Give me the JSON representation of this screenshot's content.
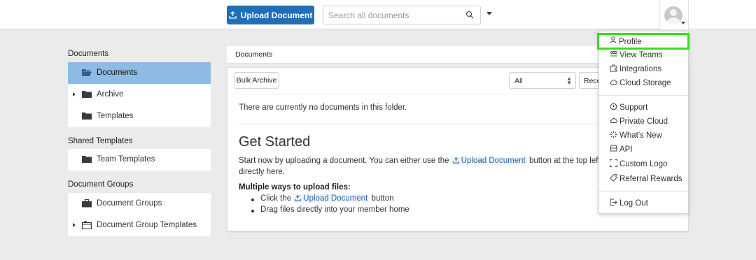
{
  "header": {
    "upload_label": "Upload Document",
    "search_placeholder": "Search all documents"
  },
  "sidebar": {
    "documents_title": "Documents",
    "documents_items": [
      {
        "label": "Documents",
        "icon": "folder-open-icon",
        "active": true
      },
      {
        "label": "Archive",
        "icon": "folder-icon",
        "expandable": true
      },
      {
        "label": "Templates",
        "icon": "folder-icon"
      }
    ],
    "shared_title": "Shared Templates",
    "shared_items": [
      {
        "label": "Team Templates",
        "icon": "folder-icon"
      }
    ],
    "groups_title": "Document Groups",
    "groups_items": [
      {
        "label": "Document Groups",
        "icon": "briefcase-icon"
      },
      {
        "label": "Document Group Templates",
        "icon": "group-template-icon",
        "expandable": true
      }
    ]
  },
  "main": {
    "breadcrumb": "Documents",
    "bulk_archive_label": "Bulk Archive",
    "filter_value": "All",
    "sort_value": "Recent",
    "empty_message": "There are currently no documents in this folder.",
    "get_started_title": "Get Started",
    "intro_before": "Start now by uploading a document. You can either use the ",
    "intro_link": "Upload Document",
    "intro_after": " button at the top left of the s",
    "intro_line2": "directly here.",
    "ways_title": "Multiple ways to upload files:",
    "bullet1_before": "Click the ",
    "bullet1_link": "Upload Document",
    "bullet1_after": " button",
    "bullet2": "Drag files directly into your member home"
  },
  "user_menu": {
    "items": [
      {
        "label": "Profile",
        "icon": "person-icon",
        "highlighted": true
      },
      {
        "label": "View Teams",
        "icon": "team-icon"
      },
      {
        "label": "Integrations",
        "icon": "puzzle-icon"
      },
      {
        "label": "Cloud Storage",
        "icon": "cloud-icon"
      },
      {
        "label": "Support",
        "icon": "support-icon"
      },
      {
        "label": "Private Cloud",
        "icon": "cloud-icon"
      },
      {
        "label": "What's New",
        "icon": "sparkle-icon"
      },
      {
        "label": "API",
        "icon": "api-icon"
      },
      {
        "label": "Custom Logo",
        "icon": "crop-icon"
      },
      {
        "label": "Referral Rewards",
        "icon": "tag-icon"
      },
      {
        "label": "Log Out",
        "icon": "logout-icon"
      }
    ]
  },
  "colors": {
    "primary": "#1f6fb8",
    "active_item": "#8dbbe4",
    "link": "#2c66a6",
    "highlight_outline": "#35dd1a"
  }
}
